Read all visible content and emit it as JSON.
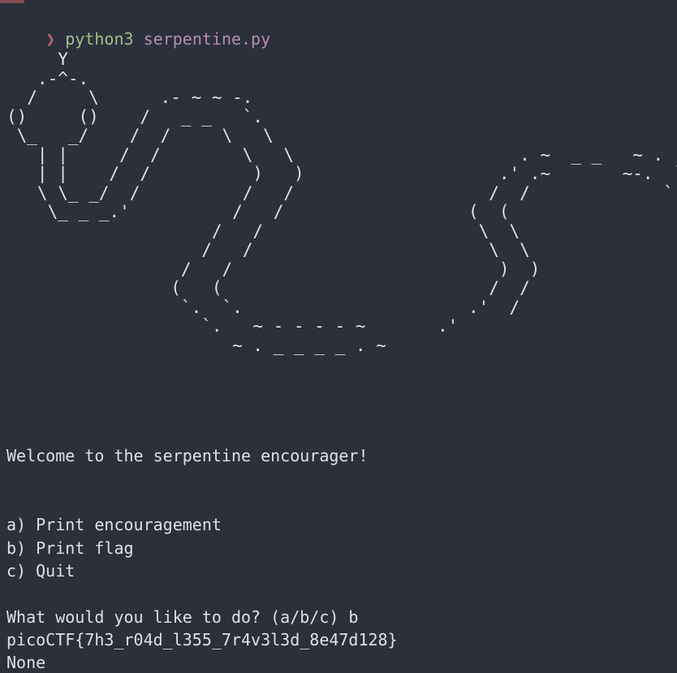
{
  "prompt": {
    "symbol": "❯",
    "command": "python3",
    "argument": "serpentine.py"
  },
  "ascii_art": "     Y\n   .-^-.\n  /     \\      .- ~ ~ -.\n()     ()    /   _ _   `.\n \\_   _/    /  /     \\   \\\n   | |     /  /        \\   \\                      . ~  _ _   ~ .\n   | |    /  /          )   )                   .' .~       ~-.  `.\n   \\ \\_ _/  /          /   /                   /  /             `. `.\n    \\_ _ _.'          /   /                  (  (                  `.'\n                    /   /                     \\  \\\n                   /   /                       \\  \\\n                 /   /                          )  )\n                (   (                          /  /\n                 `.  `.                      .'  /\n                   `.   ~ - - - - ~       .'\n                      ~ . _ _ _ _ . ~",
  "output": {
    "welcome": "Welcome to the serpentine encourager!",
    "options": [
      "a) Print encouragement",
      "b) Print flag",
      "c) Quit"
    ],
    "question": "What would you like to do? (a/b/c) b",
    "flag": "picoCTF{7h3_r04d_l355_7r4v3l3d_8e47d128}",
    "result": "None"
  },
  "colors": {
    "background": "#2b303b",
    "text": "#dfe1e8",
    "prompt_symbol": "#bf616a",
    "command": "#a3be8c",
    "argument": "#b48ead"
  }
}
